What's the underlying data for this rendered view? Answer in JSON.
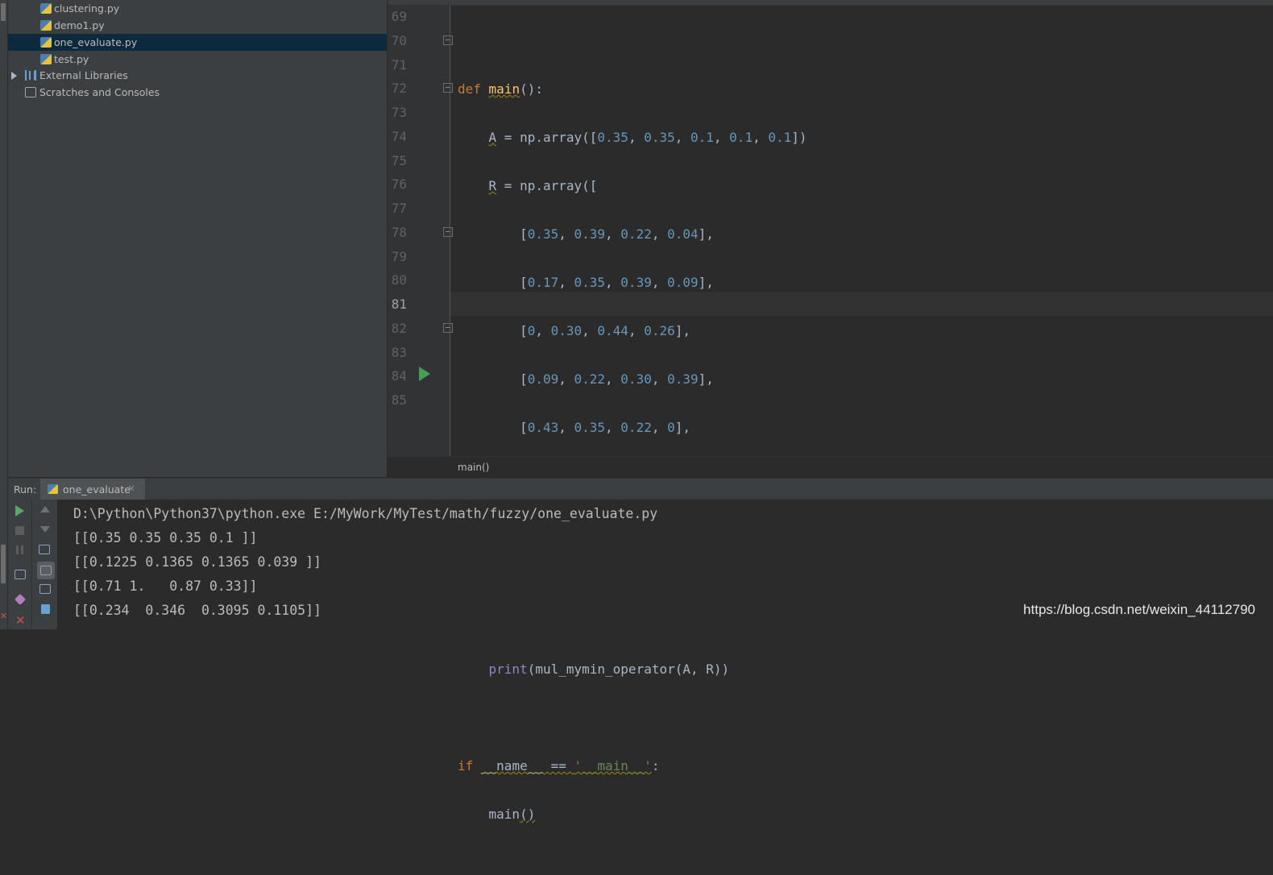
{
  "project_tree": {
    "items": [
      {
        "label": "clustering.py",
        "icon": "python-file-icon"
      },
      {
        "label": "demo1.py",
        "icon": "python-file-icon"
      },
      {
        "label": "one_evaluate.py",
        "icon": "python-file-icon",
        "selected": true
      },
      {
        "label": "test.py",
        "icon": "python-file-icon"
      },
      {
        "label": "External Libraries",
        "icon": "library-icon"
      },
      {
        "label": "Scratches and Consoles",
        "icon": "scratch-icon"
      }
    ]
  },
  "editor": {
    "line_numbers": [
      "69",
      "70",
      "71",
      "72",
      "73",
      "74",
      "75",
      "76",
      "77",
      "78",
      "79",
      "80",
      "81",
      "82",
      "83",
      "84",
      "85"
    ],
    "current_line": "81",
    "breadcrumb": "main()"
  },
  "run_panel": {
    "label": "Run:",
    "tab_label": "one_evaluate",
    "tab_close": "×",
    "console_lines": [
      "D:\\Python\\Python37\\python.exe E:/MyWork/MyTest/math/fuzzy/one_evaluate.py",
      "[[0.35 0.35 0.35 0.1 ]]",
      "[[0.1225 0.1365 0.1365 0.039 ]]",
      "[[0.71 1.   0.87 0.33]]",
      "[[0.234  0.346  0.3095 0.1105]]"
    ]
  },
  "watermark": "https://blog.csdn.net/weixin_44112790",
  "colors": {
    "keyword": "#cc7832",
    "function": "#ffc66d",
    "number": "#6897bb",
    "builtin": "#8888c6",
    "string": "#6a8759",
    "text": "#a9b7c6",
    "run_green": "#499c54"
  }
}
